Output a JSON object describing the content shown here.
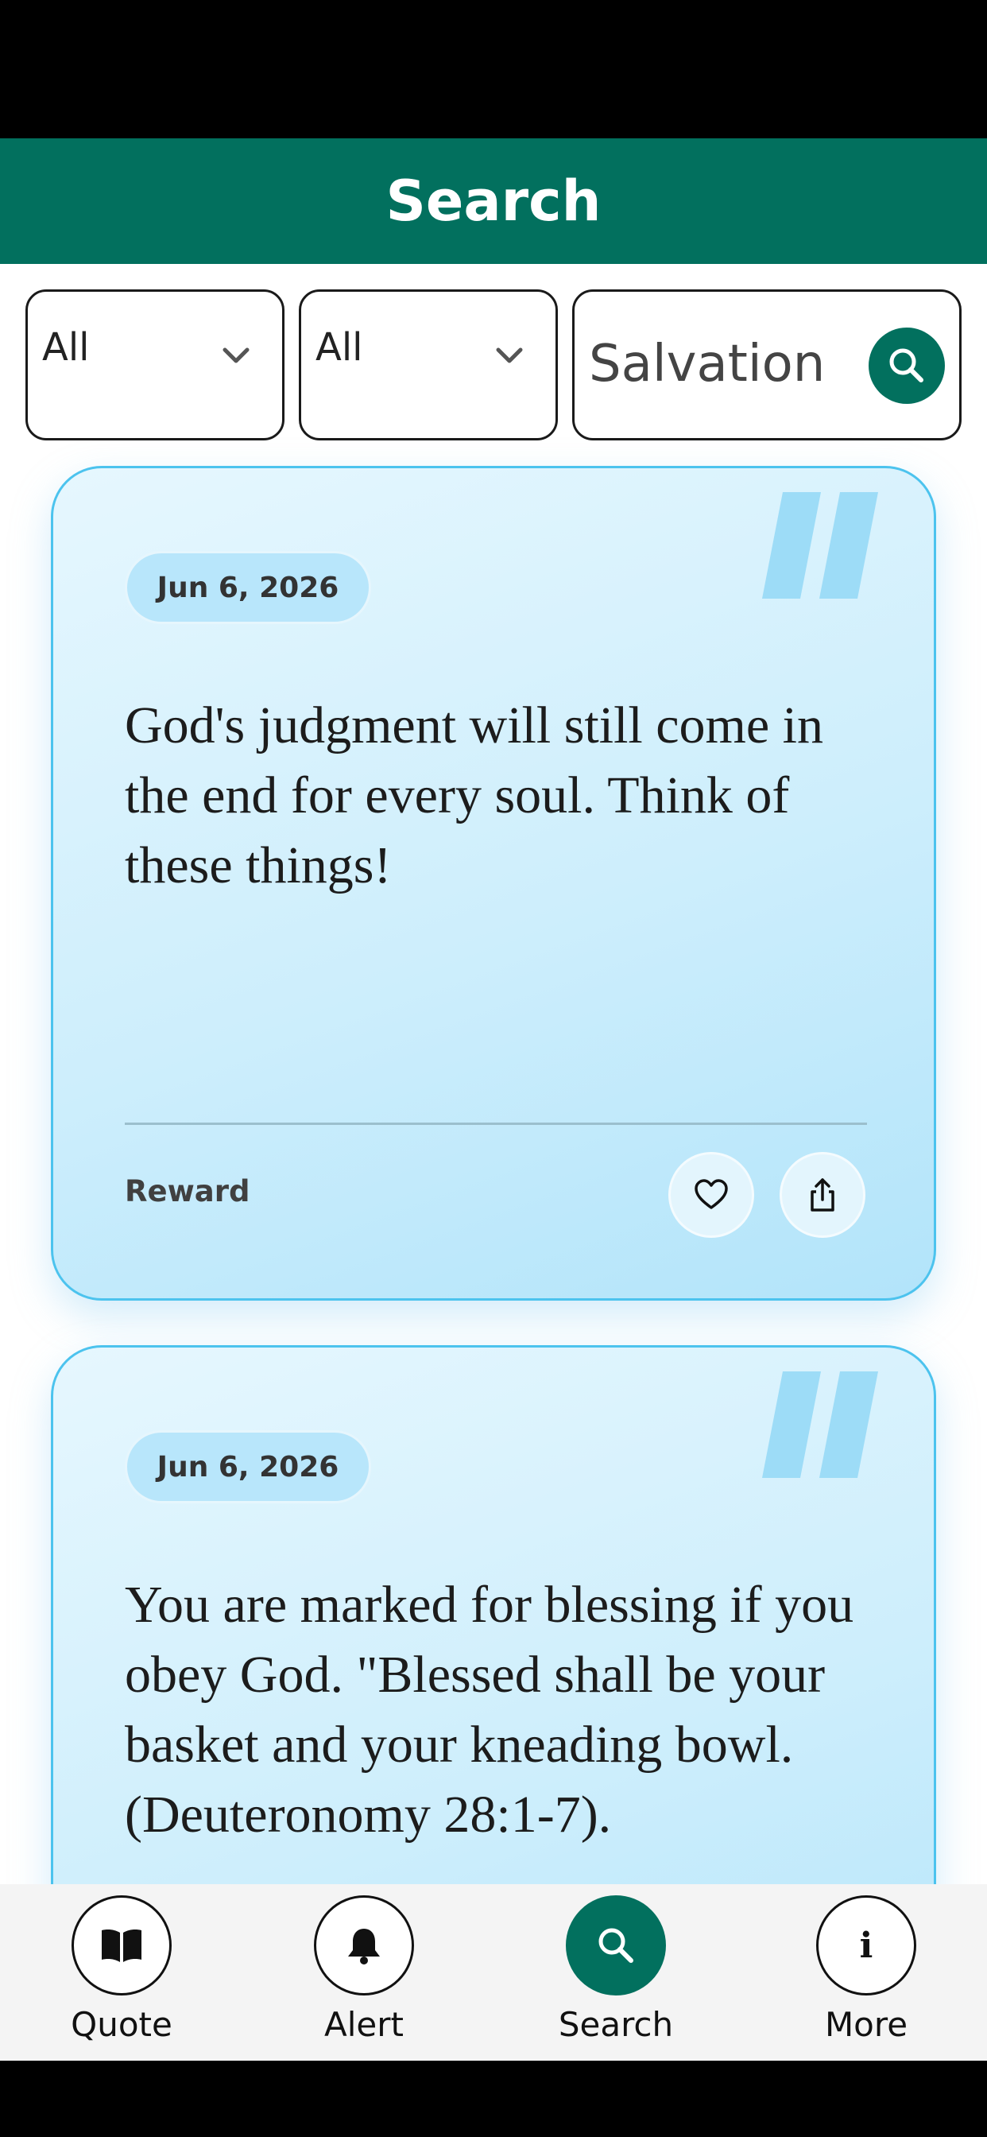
{
  "header": {
    "title": "Search"
  },
  "filters": [
    {
      "selected": "All"
    },
    {
      "selected": "All"
    }
  ],
  "search": {
    "value": "Salvation"
  },
  "cards": [
    {
      "date": "Jun 6, 2026",
      "text": "God's judgment will still come in the end for every soul. Think of these things!",
      "category": "Reward"
    },
    {
      "date": "Jun 6, 2026",
      "text": "You are marked for blessing if you obey God. \"Blessed shall be your basket and your kneading bowl. (Deuteronomy 28:1-7).",
      "category": ""
    }
  ],
  "nav": {
    "items": [
      {
        "label": "Quote",
        "icon": "book-icon"
      },
      {
        "label": "Alert",
        "icon": "bell-icon"
      },
      {
        "label": "Search",
        "icon": "search-icon"
      },
      {
        "label": "More",
        "icon": "info-icon"
      }
    ],
    "active": "Search"
  },
  "colors": {
    "primary": "#02705e",
    "card_border": "#4cc3ee",
    "card_bg": "#cdeefc",
    "quote_mark": "#9ddcf7"
  }
}
